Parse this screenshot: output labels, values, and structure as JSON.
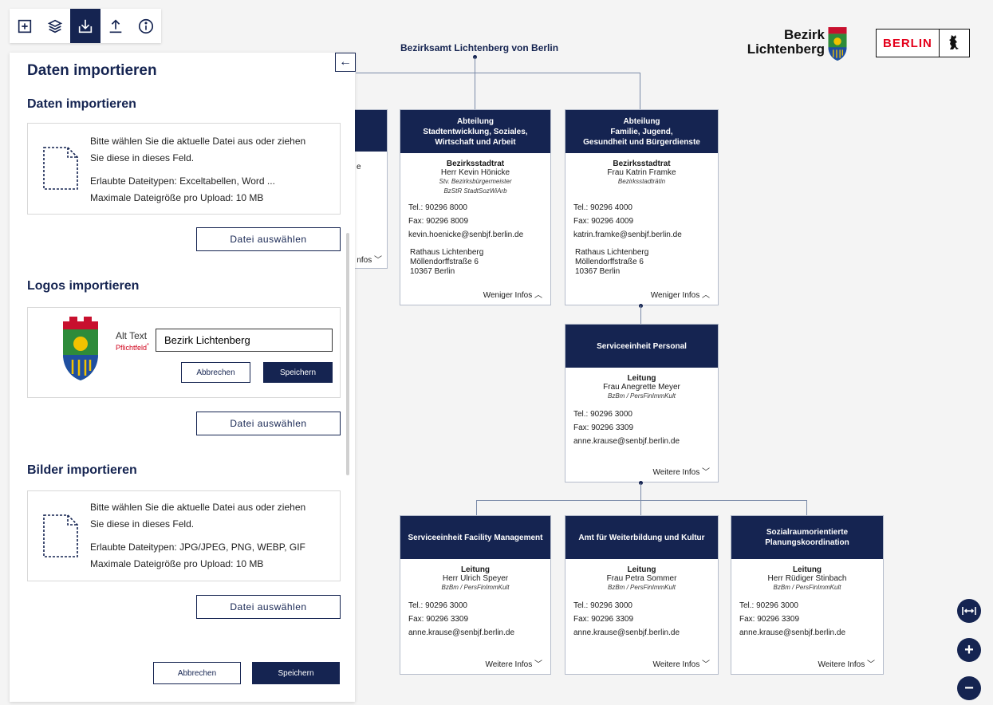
{
  "toolbar": {
    "items": [
      "add-icon",
      "layers-icon",
      "import-icon",
      "export-icon",
      "info-icon"
    ],
    "active": "import-icon"
  },
  "panel": {
    "title": "Daten importieren",
    "collapse_icon": "←",
    "data_section": {
      "title": "Daten importieren",
      "hint_line1": "Bitte wählen Sie die aktuelle Datei aus oder ziehen",
      "hint_line2": "Sie diese in dieses Feld.",
      "types": "Erlaubte Dateitypen: Exceltabellen, Word ...",
      "max_size": "Maximale Dateigröße pro Upload: 10 MB",
      "button": "Datei auswählen"
    },
    "logo_section": {
      "title": "Logos importieren",
      "alt_label": "Alt Text",
      "required_label": "Pflichtfeld",
      "required_mark": "*",
      "alt_value": "Bezirk Lichtenberg",
      "cancel": "Abbrechen",
      "save": "Speichern",
      "button": "Datei auswählen"
    },
    "image_section": {
      "title": "Bilder importieren",
      "hint_line1": "Bitte wählen Sie die aktuelle Datei aus oder ziehen",
      "hint_line2": "Sie diese in dieses Feld.",
      "types": "Erlaubte Dateitypen: JPG/JPEG, PNG, WEBP, GIF",
      "max_size": "Maximale Dateigröße pro Upload: 10 MB",
      "button": "Datei auswählen"
    },
    "footer": {
      "cancel": "Abbrechen",
      "save": "Speichern"
    }
  },
  "org": {
    "root": "Bezirksamt Lichtenberg von Berlin",
    "hidden_card": {
      "fragment": "e",
      "more": "nfos"
    },
    "cards": [
      {
        "head_line1": "Abteilung",
        "head_line2": "Stadtentwicklung, Soziales,",
        "head_line3": "Wirtschaft und Arbeit",
        "role": "Bezirksstadtrat",
        "person": "Herr Kevin Hönicke",
        "meta1": "Stv. Bezirksbürgermeister",
        "meta2": "BzStR StadtSozWiArb",
        "tel": "Tel.: 90296 8000",
        "fax": "Fax: 90296 8009",
        "email": "kevin.hoenicke@senbjf.berlin.de",
        "addr1": "Rathaus Lichtenberg",
        "addr2": "Möllendorffstraße 6",
        "addr3": "10367 Berlin",
        "more": "Weniger Infos"
      },
      {
        "head_line1": "Abteilung",
        "head_line2": "Familie, Jugend,",
        "head_line3": "Gesundheit und Bürgerdienste",
        "role": "Bezirksstadtrat",
        "person": "Frau Katrin Framke",
        "meta1": "Bezirksstadträtin",
        "meta2": "",
        "tel": "Tel.: 90296 4000",
        "fax": "Fax: 90296 4009",
        "email": "katrin.framke@senbjf.berlin.de",
        "addr1": "Rathaus Lichtenberg",
        "addr2": "Möllendorffstraße 6",
        "addr3": "10367 Berlin",
        "more": "Weniger Infos"
      },
      {
        "head": "Serviceeinheit Personal",
        "role": "Leitung",
        "person": "Frau Anegrette Meyer",
        "meta1": "BzBm / PersFinImmKult",
        "tel": "Tel.: 90296 3000",
        "fax": "Fax: 90296 3309",
        "email": "anne.krause@senbjf.berlin.de",
        "more": "Weitere Infos"
      },
      {
        "head": "Serviceeinheit Facility Management",
        "role": "Leitung",
        "person": "Herr Ulrich Speyer",
        "meta1": "BzBm / PersFinImmKult",
        "tel": "Tel.: 90296 3000",
        "fax": "Fax: 90296 3309",
        "email": "anne.krause@senbjf.berlin.de",
        "more": "Weitere Infos"
      },
      {
        "head": "Amt für Weiterbildung und Kultur",
        "role": "Leitung",
        "person": "Frau Petra Sommer",
        "meta1": "BzBm / PersFinImmKult",
        "tel": "Tel.: 90296 3000",
        "fax": "Fax: 90296 3309",
        "email": "anne.krause@senbjf.berlin.de",
        "more": "Weitere Infos"
      },
      {
        "head_line1": "Sozialraumorientierte",
        "head_line2": "Planungskoordination",
        "role": "Leitung",
        "person": "Herr Rüdiger Stinbach",
        "meta1": "BzBm / PersFinImmKult",
        "tel": "Tel.: 90296 3000",
        "fax": "Fax: 90296 3309",
        "email": "anne.krause@senbjf.berlin.de",
        "more": "Weitere Infos"
      }
    ]
  },
  "branding": {
    "bezirk_line1": "Bezirk",
    "bezirk_line2": "Lichtenberg",
    "berlin_word": "BERLIN"
  },
  "zoom": {
    "fit_icon": "fit-width-icon",
    "plus": "+",
    "minus": "−"
  },
  "colors": {
    "navy": "#152451",
    "red": "#e4001b"
  }
}
